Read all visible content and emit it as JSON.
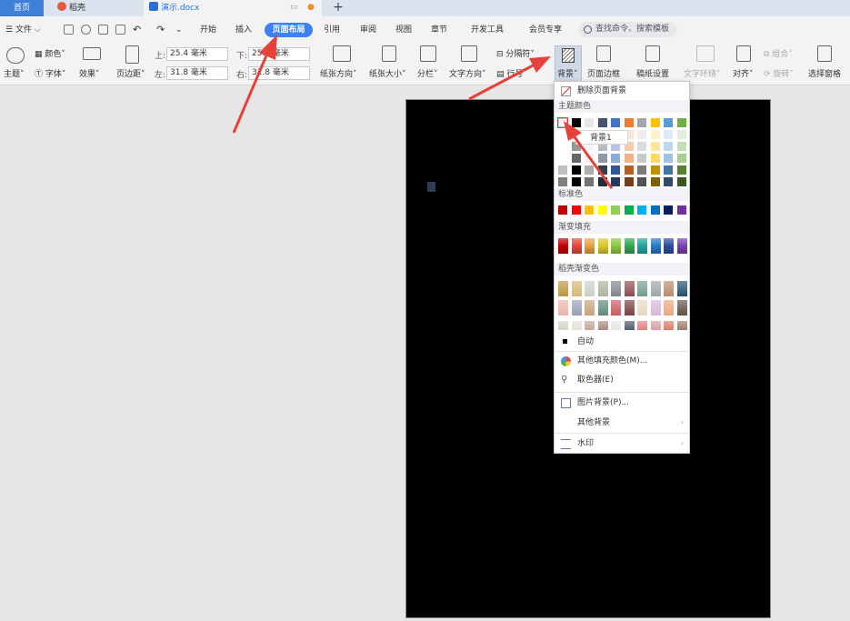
{
  "tabs": {
    "home": "首页",
    "daoke": "稻壳",
    "document": "演示.docx"
  },
  "menu_bar": {
    "file": "文件",
    "items": [
      "开始",
      "插入",
      "页面布局",
      "引用",
      "审阅",
      "视图",
      "章节",
      "开发工具",
      "会员专享"
    ],
    "active": "页面布局",
    "search_placeholder": "查找命令、搜索模板"
  },
  "ribbon": {
    "theme": "主题",
    "colors": "颜色",
    "fonts": "字体",
    "effects": "效果",
    "margins": "页边距",
    "margin_top_label": "上:",
    "margin_top": "25.4 毫米",
    "margin_left_label": "左:",
    "margin_left": "31.8 毫米",
    "margin_bottom_label": "下:",
    "margin_bottom": "25.4 毫米",
    "margin_right_label": "右:",
    "margin_right": "31.8 毫米",
    "orientation": "纸张方向",
    "size": "纸张大小",
    "columns": "分栏",
    "text_direction": "文字方向",
    "separator": "分隔符",
    "line_number": "行号",
    "background": "背景",
    "page_border": "页面边框",
    "manuscript": "稿纸设置",
    "text_wrap": "文字环绕",
    "align": "对齐",
    "rotate": "旋转",
    "group": "组合",
    "selection_pane": "选择窗格"
  },
  "background_menu": {
    "remove_bg": "删除页面背景",
    "theme_colors": "主题颜色",
    "tooltip": "背景1",
    "standard_colors": "标准色",
    "gradient_fill": "渐变填充",
    "daoke_gradient": "稻壳渐变色",
    "auto": "自动",
    "more_colors": "其他填充颜色(M)...",
    "eyedropper": "取色器(E)",
    "picture_bg": "图片背景(P)...",
    "other_bg": "其他背景",
    "watermark": "水印"
  },
  "colors": {
    "accent": "#3b82f6",
    "page": "#000000",
    "arrow": "#e8413a",
    "theme_top_row": [
      "#ffffff",
      "#000000",
      "#e7e6e6",
      "#44546a",
      "#4472c4",
      "#ed7d31",
      "#a5a5a5",
      "#ffc000",
      "#5b9bd5",
      "#70ad47"
    ],
    "standard": [
      "#c00000",
      "#ff0000",
      "#ffc000",
      "#ffff00",
      "#92d050",
      "#00b050",
      "#00b0f0",
      "#0070c0",
      "#002060",
      "#7030a0"
    ],
    "gradient": [
      "#c00000",
      "#e8453a",
      "#e8a23a",
      "#d8c72a",
      "#8cc63f",
      "#2fa84f",
      "#1fa6a0",
      "#2b77c9",
      "#2f4b9a",
      "#7a3fb0"
    ],
    "daoke_row1": [
      "#b9963f",
      "#d8b870",
      "#c9d1c3",
      "#a9b4a0",
      "#7e868f",
      "#8d4b4b",
      "#6f9e8c",
      "#9aa7a4",
      "#b98a6d",
      "#1f4e6e"
    ],
    "daoke_row2": [
      "#e8b4a8",
      "#9b9fb8",
      "#c6a27a",
      "#5d8a7b",
      "#c75a62",
      "#7c3d3d",
      "#e8d8c2",
      "#d6b7d6",
      "#e8a77c",
      "#5f5046"
    ],
    "daoke_row3": [
      "#cfd6c6",
      "#e7dfd6",
      "#c5a896",
      "#a98c80",
      "#e6e6e6",
      "#50596e",
      "#e67f7f",
      "#d8a0a0",
      "#d97c6a",
      "#9b7d6d"
    ]
  }
}
